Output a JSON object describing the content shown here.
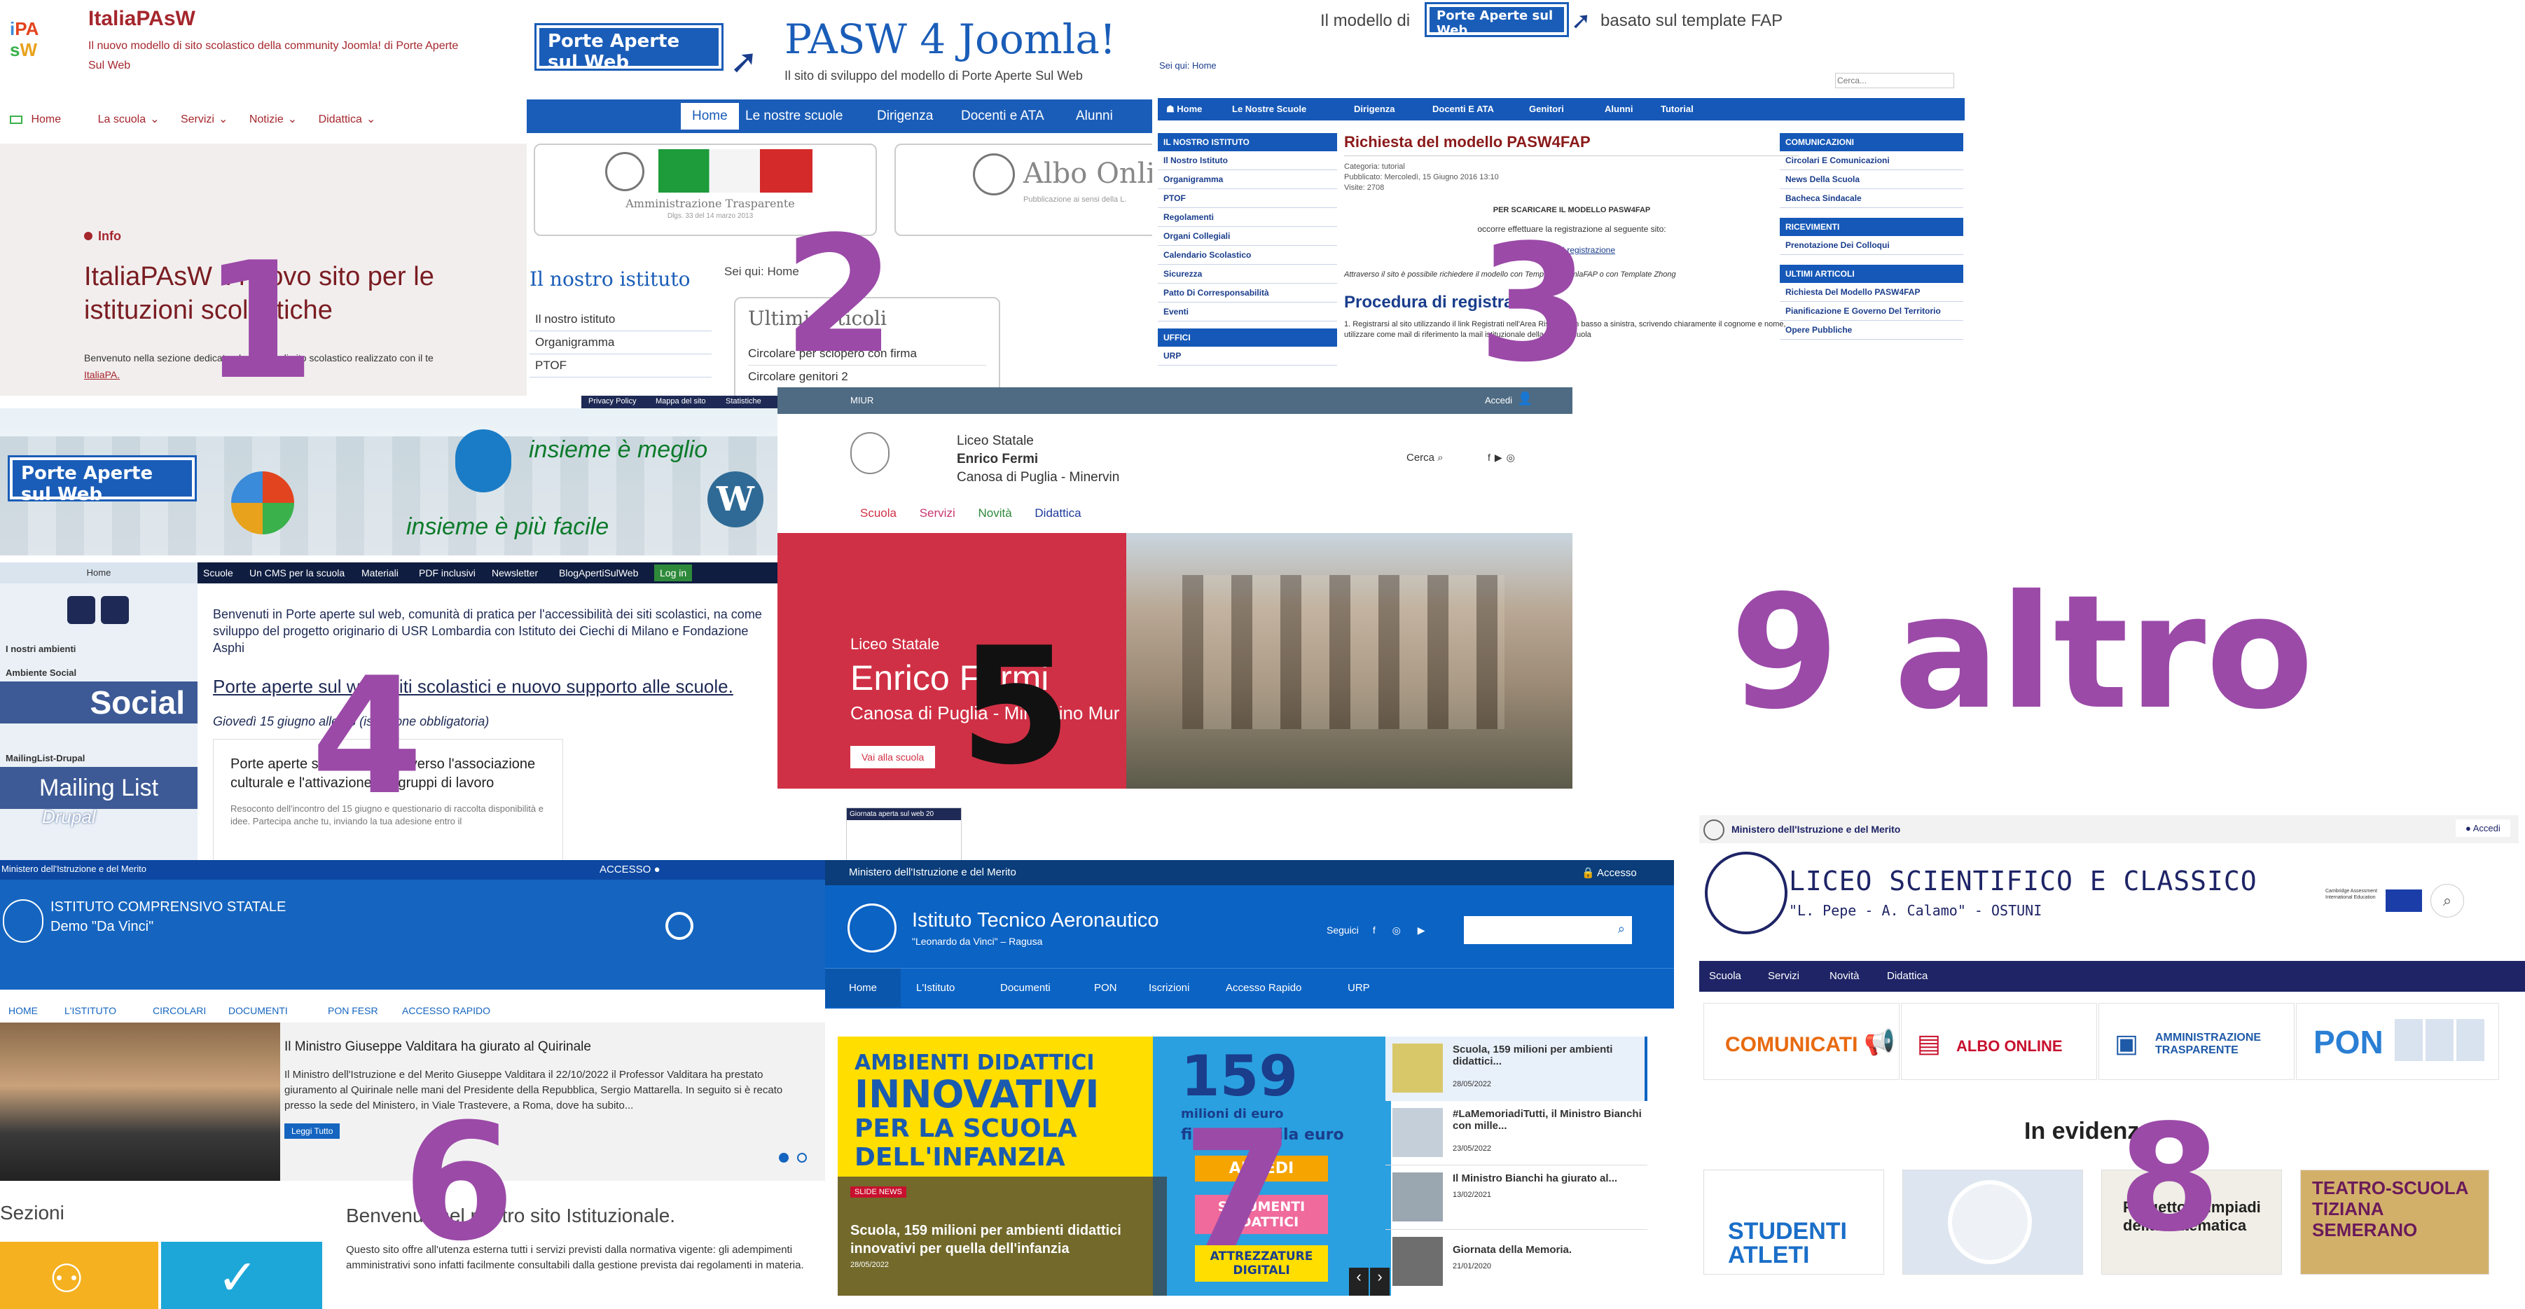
{
  "p1": {
    "logo": "iPAsW",
    "site_title": "ItaliaPAsW",
    "tagline": "Il nuovo modello di sito scolastico della community Joomla! di Porte Aperte Sul Web",
    "nav": [
      "Home",
      "La scuola",
      "Servizi",
      "Notizie",
      "Didattica"
    ],
    "info_label": "Info",
    "heading": "ItaliaPAsW il nuovo sito per le istituzioni scolastiche",
    "body": "Benvenuto nella sezione dedicata al modello di sito scolastico realizzato con il te",
    "link": "ItaliaPA."
  },
  "p2": {
    "logo": "Porte Aperte sul Web",
    "logo_sub": "⠏⠕⠗⠞⠑ ⠁⠏⠑⠗⠞⠑",
    "title": "PASW 4 Joomla!",
    "subtitle": "Il sito di sviluppo del modello di Porte Aperte Sul Web",
    "nav": [
      "Home",
      "Le nostre scuole",
      "Dirigenza",
      "Docenti e ATA",
      "Alunni"
    ],
    "banner1": "Amministrazione Trasparente",
    "banner1_sub": "Dlgs. 33 del 14 marzo 2013",
    "banner2": "Albo Onli",
    "banner2_sub": "Pubblicazione ai sensi della L.",
    "sidebar_title": "Il nostro istituto",
    "sidebar": [
      "Il nostro istituto",
      "Organigramma",
      "PTOF"
    ],
    "breadcrumb_label": "Sei qui:",
    "breadcrumb": "Home",
    "latest_title": "Ultimi articoli",
    "latest": [
      "Circolare per sciopero con firma",
      "Circolare genitori 2"
    ]
  },
  "p3": {
    "tagline_pre": "Il modello di",
    "logo": "Porte Aperte sul Web",
    "tagline_post": "basato sul template FAP",
    "breadcrumb": "Sei qui: Home",
    "search_placeholder": "Cerca...",
    "nav": [
      "Home",
      "Le Nostre Scuole",
      "Dirigenza",
      "Docenti E ATA",
      "Genitori",
      "Alunni",
      "Tutorial"
    ],
    "left_title": "IL NOSTRO ISTITUTO",
    "left": [
      "Il Nostro Istituto",
      "Organigramma",
      "PTOF",
      "Regolamenti",
      "Organi Collegiali",
      "Calendario Scolastico",
      "Sicurezza",
      "Patto Di Corresponsabilità",
      "Eventi"
    ],
    "left_title2": "UFFICI",
    "left2": "URP",
    "article_title": "Richiesta del modello PASW4FAP",
    "meta": [
      "Categoria: tutorial",
      "Pubblicato: Mercoledì, 15 Giugno 2016 13:10",
      "Visite: 2708"
    ],
    "download_title": "PER SCARICARE IL MODELLO PASW4FAP",
    "download_text": "occorre effettuare la registrazione al seguente sito:",
    "download_link": "Modulo di registrazione",
    "italic_text": "Attraverso il sito è possibile richiedere il modello con Template JoomlaFAP o con Template Zhong",
    "procedure_title": "Procedura di registrazione",
    "procedure_text": "1. Registrarsi al sito utilizzando il link Registrati nell'Area Riservata in basso a sinistra, scrivendo chiaramente il cognome e nome, utilizzare come mail di riferimento la mail istituzionale della vostra scuola",
    "right_sections": [
      {
        "title": "COMUNICAZIONI",
        "items": [
          "Circolari E Comunicazioni",
          "News Della Scuola",
          "Bacheca Sindacale"
        ]
      },
      {
        "title": "RICEVIMENTI",
        "items": [
          "Prenotazione Dei Colloqui"
        ]
      },
      {
        "title": "ULTIMI ARTICOLI",
        "items": [
          "Richiesta Del Modello PASW4FAP",
          "Pianificazione E Governo Del Territorio",
          "Opere Pubbliche"
        ]
      }
    ]
  },
  "p4": {
    "top_links": [
      "Privacy Policy",
      "Mappa del sito",
      "Statistiche"
    ],
    "logo": "Porte Aperte sul Web",
    "slogan1": "insieme è meglio",
    "slogan2": "insieme è più facile",
    "home_label": "Home",
    "nav": [
      "Scuole",
      "Un CMS per la scuola",
      "Materiali",
      "PDF inclusivi",
      "Newsletter",
      "BlogApertiSulWeb",
      "Log in"
    ],
    "left": [
      "I nostri ambienti",
      "Ambiente Social",
      "Social",
      "MailingList-Drupal",
      "Mailing List",
      "Drupal"
    ],
    "intro": "Benvenuti in Porte aperte sul web, comunità di pratica per l'accessibilità dei siti scolastici, na come sviluppo del progetto originario di USR Lombardia con Istituto dei Ciechi di Milano e Fondazione Asphi",
    "headline": "Porte aperte sul web, siti scolastici e nuovo supporto alle scuole.",
    "date_note": "Giovedì 15 giugno alle 18 (iscrizione obbligatoria)",
    "card_title": "Porte aperte sul web riparte: verso l'associazione culturale e l'attivazione dei gruppi di lavoro",
    "card_text": "Resoconto dell'incontro del 15 giugno e questionario di raccolta disponibilità e idee. Partecipa anche tu, inviando la tua adesione entro il"
  },
  "p5": {
    "topbar": "MIUR",
    "login": "Accedi",
    "school_type": "Liceo Statale",
    "school_name": "Enrico Fermi",
    "school_city": "Canosa di Puglia - Minervin",
    "search": "Cerca",
    "nav": [
      "Scuola",
      "Servizi",
      "Novità",
      "Didattica"
    ],
    "hero_type": "Liceo Statale",
    "hero_name": "Enrico Fermi",
    "hero_city": "Canosa di Puglia - Minervino Mur",
    "hero_button": "Vai alla scuola",
    "badge": "Giornata aperta sul web 20"
  },
  "p6": {
    "ministry": "Ministero dell'Istruzione e del Merito",
    "access": "ACCESSO",
    "school_type": "ISTITUTO COMPRENSIVO STATALE",
    "school_name": "Demo \"Da Vinci\"",
    "nav": [
      "HOME",
      "L'ISTITUTO",
      "CIRCOLARI",
      "DOCUMENTI",
      "PON FESR",
      "ACCESSO RAPIDO"
    ],
    "news_title": "Il Ministro Giuseppe Valditara ha giurato al Quirinale",
    "news_text": "Il Ministro dell'Istruzione e del Merito Giuseppe Valditara il 22/10/2022 il Professor Valditara ha prestato giuramento al Quirinale nelle mani del Presidente della Repubblica, Sergio Mattarella. In seguito si è recato presso la sede del Ministero, in Viale Trastevere, a Roma, dove ha subito...",
    "read_more": "Leggi Tutto",
    "sections_title": "Sezioni",
    "welcome": "Benvenuti nel nostro sito Istituzionale.",
    "welcome_text": "Questo sito offre all'utenza esterna tutti i servizi previsti dalla normativa vigente: gli adempimenti amministrativi sono infatti facilmente consultabili dalla gestione prevista dai regolamenti in materia."
  },
  "p7": {
    "ministry": "Ministero dell'Istruzione e del Merito",
    "access": "Accesso",
    "school_name": "Istituto Tecnico Aeronautico",
    "school_sub": "\"Leonardo da Vinci\" – Ragusa",
    "follow": "Seguici",
    "nav": [
      "Home",
      "L'Istituto",
      "Documenti",
      "PON",
      "Iscrizioni",
      "Accesso Rapido",
      "URP"
    ],
    "hero_lines": [
      "AMBIENTI DIDATTICI",
      "INNOVATIVI",
      "PER LA SCUOLA",
      "DELL'INFANZIA"
    ],
    "hero_big": "159",
    "hero_big_sub": "milioni di euro",
    "hero_mid": "fino a 75 mila euro",
    "hero_tags": [
      "ARREDI",
      "STRUMENTI DIDATTICI",
      "ATTREZZATURE DIGITALI"
    ],
    "slide_tag": "SLIDE NEWS",
    "slide_title": "Scuola, 159 milioni per ambienti didattici innovativi per quella dell'infanzia",
    "slide_date": "28/05/2022",
    "news": [
      {
        "title": "Scuola, 159 milioni per ambienti didattici...",
        "date": "28/05/2022"
      },
      {
        "title": "#LaMemoriadiTutti, il Ministro Bianchi con mille...",
        "date": "23/05/2022"
      },
      {
        "title": "Il Ministro Bianchi ha giurato al...",
        "date": "13/02/2021"
      },
      {
        "title": "Giornata della Memoria.",
        "date": "21/01/2020"
      }
    ]
  },
  "p8": {
    "ministry": "Ministero dell'Istruzione e del Merito",
    "login": "Accedi",
    "title": "LICEO SCIENTIFICO E CLASSICO",
    "subtitle": "\"L. Pepe - A. Calamo\" - OSTUNI",
    "cambridge": "Cambridge Assessment International Education",
    "nav": [
      "Scuola",
      "Servizi",
      "Novità",
      "Didattica"
    ],
    "quick": [
      "COMUNICATI",
      "ALBO ONLINE",
      "AMMINISTRAZIONE TRASPARENTE",
      "PON"
    ],
    "highlight": "In evidenza",
    "cards": [
      "STUDENTI ATLETI",
      "",
      "Progetto Olimpiadi della Matematica",
      "TEATRO-SCUOLA TIZIANA SEMERANO"
    ]
  },
  "labels": {
    "n1": "1",
    "n2": "2",
    "n3": "3",
    "n4": "4",
    "n5": "5",
    "n6": "6",
    "n7": "7",
    "n8": "8",
    "altro": "9 altro"
  },
  "colors": {
    "purple": "#9b4aa8",
    "pasw_blue": "#1a5db8",
    "p1_red": "#a5262d",
    "p5_red": "#d03045",
    "p6_blue": "#1565c0",
    "p7_blue": "#0b63c4",
    "p8_navy": "#1e2466"
  }
}
